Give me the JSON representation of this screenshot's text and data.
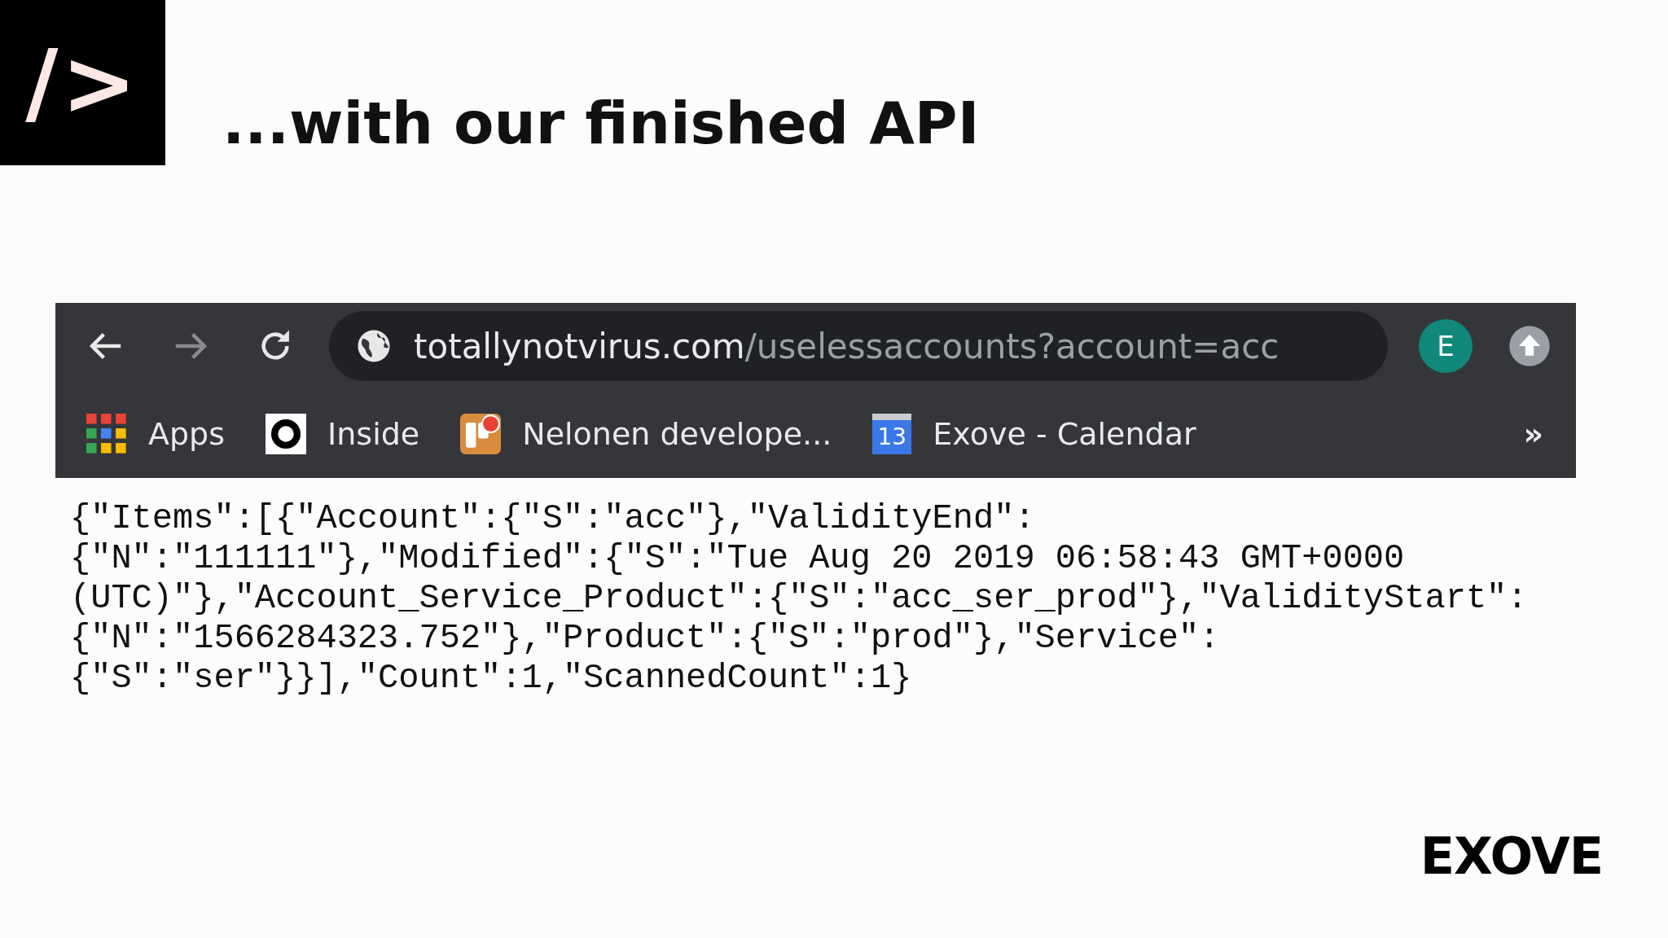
{
  "slide": {
    "logo_mark": "/>",
    "title": "...with our finished API",
    "brand": "EXOVE"
  },
  "browser": {
    "url": {
      "host": "totallynotvirus.com",
      "path": "/uselessaccounts?account=acc"
    },
    "profile_initial": "E",
    "bookmarks": [
      {
        "label": "Apps",
        "kind": "apps"
      },
      {
        "label": "Inside",
        "kind": "ring"
      },
      {
        "label": "Nelonen develope...",
        "kind": "board"
      },
      {
        "label": "Exove - Calendar",
        "kind": "calendar",
        "day": "13"
      }
    ],
    "overflow": "»"
  },
  "response_lines": [
    "{\"Items\":[{\"Account\":{\"S\":\"acc\"},\"ValidityEnd\":",
    "{\"N\":\"111111\"},\"Modified\":{\"S\":\"Tue Aug 20 2019 06:58:43 GMT+0000",
    "(UTC)\"},\"Account_Service_Product\":{\"S\":\"acc_ser_prod\"},\"ValidityStart\":",
    "{\"N\":\"1566284323.752\"},\"Product\":{\"S\":\"prod\"},\"Service\":",
    "{\"S\":\"ser\"}}],\"Count\":1,\"ScannedCount\":1}"
  ]
}
